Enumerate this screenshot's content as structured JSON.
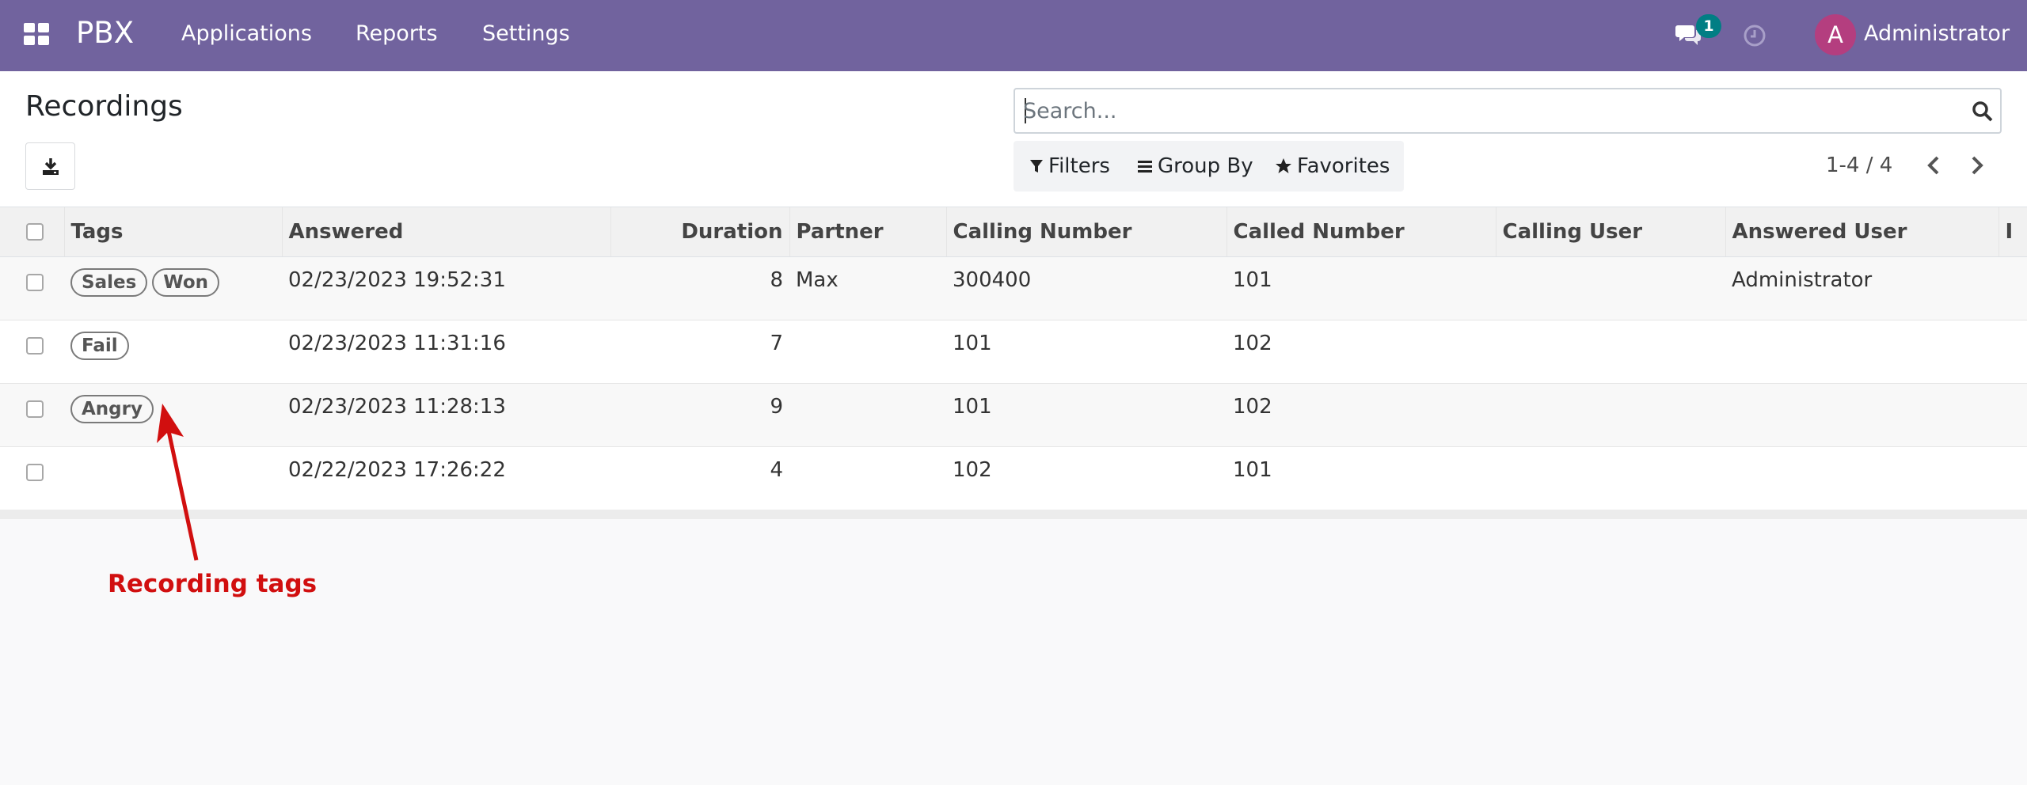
{
  "navbar": {
    "brand": "PBX",
    "menu": [
      {
        "label": "Applications"
      },
      {
        "label": "Reports"
      },
      {
        "label": "Settings"
      }
    ],
    "chat_count": "1",
    "user_initial": "A",
    "user_name": "Administrator",
    "background_color": "#71639e"
  },
  "control_panel": {
    "title": "Recordings",
    "search_placeholder": "Search...",
    "filters_label": "Filters",
    "group_by_label": "Group By",
    "favorites_label": "Favorites",
    "pager_value": "1-4 / 4"
  },
  "table": {
    "headers": {
      "tags": "Tags",
      "answered": "Answered",
      "duration": "Duration",
      "partner": "Partner",
      "calling_number": "Calling Number",
      "called_number": "Called Number",
      "calling_user": "Calling User",
      "answered_user": "Answered User",
      "extra": "I"
    },
    "rows": [
      {
        "tags": [
          "Sales",
          "Won"
        ],
        "answered": "02/23/2023 19:52:31",
        "duration": "8",
        "partner": "Max",
        "calling_number": "300400",
        "called_number": "101",
        "calling_user": "",
        "answered_user": "Administrator"
      },
      {
        "tags": [
          "Fail"
        ],
        "answered": "02/23/2023 11:31:16",
        "duration": "7",
        "partner": "",
        "calling_number": "101",
        "called_number": "102",
        "calling_user": "",
        "answered_user": ""
      },
      {
        "tags": [
          "Angry"
        ],
        "answered": "02/23/2023 11:28:13",
        "duration": "9",
        "partner": "",
        "calling_number": "101",
        "called_number": "102",
        "calling_user": "",
        "answered_user": ""
      },
      {
        "tags": [],
        "answered": "02/22/2023 17:26:22",
        "duration": "4",
        "partner": "",
        "calling_number": "102",
        "called_number": "101",
        "calling_user": "",
        "answered_user": ""
      }
    ]
  },
  "annotation": {
    "label": "Recording tags",
    "color": "#d10f0f"
  }
}
